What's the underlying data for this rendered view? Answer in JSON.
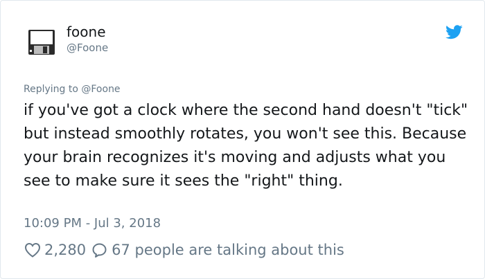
{
  "user": {
    "name": "foone",
    "handle": "@Foone"
  },
  "reply": {
    "text": "Replying to @Foone"
  },
  "tweet": {
    "text": "if you've got a clock where the second hand doesn't \"tick\" but instead smoothly rotates, you won't see this. Because your brain recognizes it's moving and adjusts what you see to make sure it sees the \"right\" thing.",
    "timestamp": "10:09 PM - Jul 3, 2018"
  },
  "actions": {
    "likes": "2,280",
    "talking": "67 people are talking about this"
  },
  "colors": {
    "twitter_blue": "#1da1f2",
    "muted": "#657786",
    "text": "#14171a"
  },
  "icons": {
    "avatar": "floppy-disk-avatar",
    "logo": "twitter-bird-icon",
    "like": "heart-icon",
    "reply": "comment-bubble-icon"
  }
}
